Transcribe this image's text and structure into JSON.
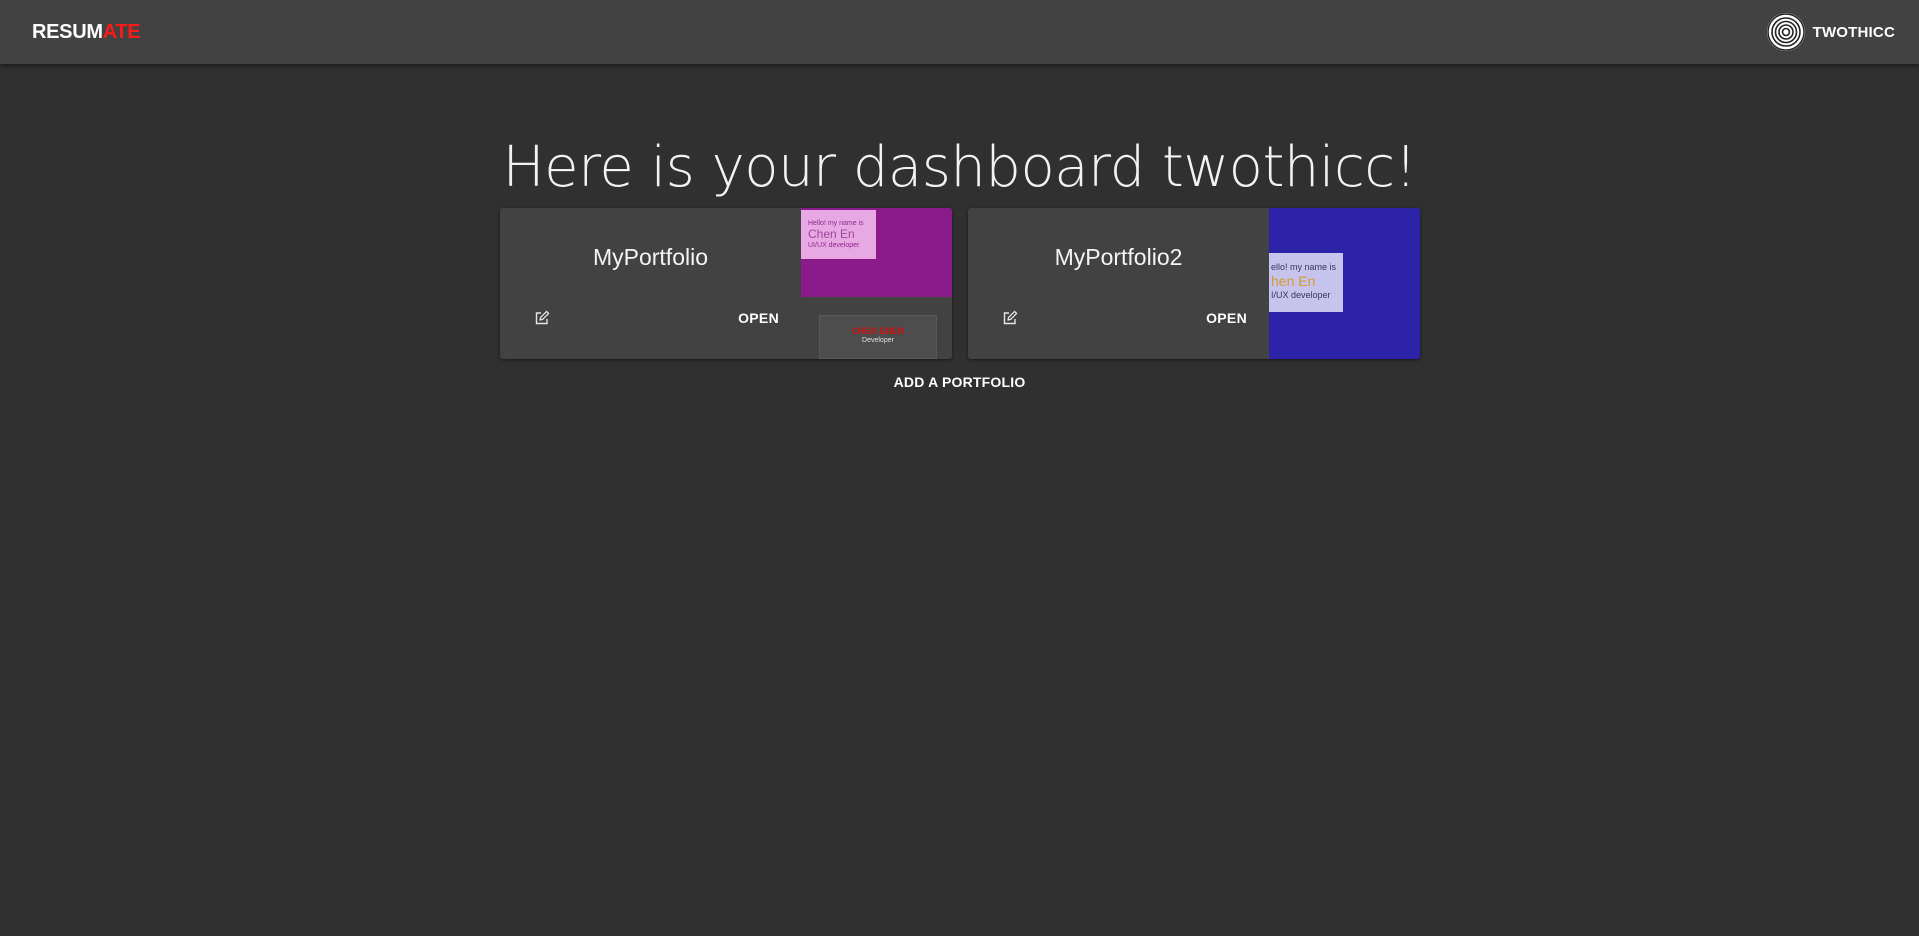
{
  "header": {
    "logo_part_a": "RESUM",
    "logo_part_b": "ATE",
    "logo_accent_color": "#ff1a1a",
    "username": "TWOTHICC",
    "avatar_icon": "concentric-circles-avatar-icon"
  },
  "main": {
    "title": "Here is your dashboard twothicc!",
    "portfolios": [
      {
        "name": "MyPortfolio",
        "open_label": "OPEN",
        "edit_icon": "edit-icon",
        "preview": {
          "accent_color": "#8b1a8b",
          "greeting": "Hello! my name is",
          "person_name": "Chen En",
          "role": "UI/UX developer",
          "card_name": "CHEN ENEN",
          "card_role": "Developer"
        }
      },
      {
        "name": "MyPortfolio2",
        "open_label": "OPEN",
        "edit_icon": "edit-icon",
        "preview": {
          "accent_color": "#2c23a8",
          "greeting": "ello! my name is",
          "person_name": "hen En",
          "role": "I/UX developer"
        }
      }
    ],
    "add_label": "ADD A PORTFOLIO"
  }
}
